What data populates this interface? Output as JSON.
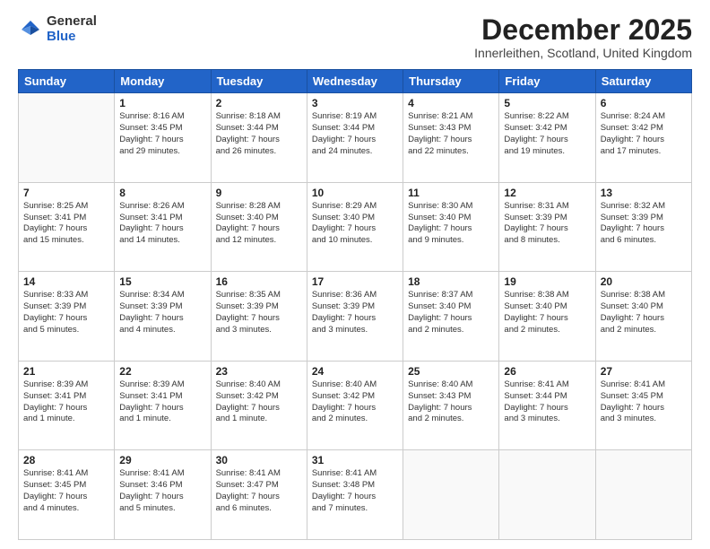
{
  "header": {
    "logo_general": "General",
    "logo_blue": "Blue",
    "month_title": "December 2025",
    "location": "Innerleithen, Scotland, United Kingdom"
  },
  "weekdays": [
    "Sunday",
    "Monday",
    "Tuesday",
    "Wednesday",
    "Thursday",
    "Friday",
    "Saturday"
  ],
  "weeks": [
    [
      {
        "day": "",
        "info": ""
      },
      {
        "day": "1",
        "info": "Sunrise: 8:16 AM\nSunset: 3:45 PM\nDaylight: 7 hours\nand 29 minutes."
      },
      {
        "day": "2",
        "info": "Sunrise: 8:18 AM\nSunset: 3:44 PM\nDaylight: 7 hours\nand 26 minutes."
      },
      {
        "day": "3",
        "info": "Sunrise: 8:19 AM\nSunset: 3:44 PM\nDaylight: 7 hours\nand 24 minutes."
      },
      {
        "day": "4",
        "info": "Sunrise: 8:21 AM\nSunset: 3:43 PM\nDaylight: 7 hours\nand 22 minutes."
      },
      {
        "day": "5",
        "info": "Sunrise: 8:22 AM\nSunset: 3:42 PM\nDaylight: 7 hours\nand 19 minutes."
      },
      {
        "day": "6",
        "info": "Sunrise: 8:24 AM\nSunset: 3:42 PM\nDaylight: 7 hours\nand 17 minutes."
      }
    ],
    [
      {
        "day": "7",
        "info": "Sunrise: 8:25 AM\nSunset: 3:41 PM\nDaylight: 7 hours\nand 15 minutes."
      },
      {
        "day": "8",
        "info": "Sunrise: 8:26 AM\nSunset: 3:41 PM\nDaylight: 7 hours\nand 14 minutes."
      },
      {
        "day": "9",
        "info": "Sunrise: 8:28 AM\nSunset: 3:40 PM\nDaylight: 7 hours\nand 12 minutes."
      },
      {
        "day": "10",
        "info": "Sunrise: 8:29 AM\nSunset: 3:40 PM\nDaylight: 7 hours\nand 10 minutes."
      },
      {
        "day": "11",
        "info": "Sunrise: 8:30 AM\nSunset: 3:40 PM\nDaylight: 7 hours\nand 9 minutes."
      },
      {
        "day": "12",
        "info": "Sunrise: 8:31 AM\nSunset: 3:39 PM\nDaylight: 7 hours\nand 8 minutes."
      },
      {
        "day": "13",
        "info": "Sunrise: 8:32 AM\nSunset: 3:39 PM\nDaylight: 7 hours\nand 6 minutes."
      }
    ],
    [
      {
        "day": "14",
        "info": "Sunrise: 8:33 AM\nSunset: 3:39 PM\nDaylight: 7 hours\nand 5 minutes."
      },
      {
        "day": "15",
        "info": "Sunrise: 8:34 AM\nSunset: 3:39 PM\nDaylight: 7 hours\nand 4 minutes."
      },
      {
        "day": "16",
        "info": "Sunrise: 8:35 AM\nSunset: 3:39 PM\nDaylight: 7 hours\nand 3 minutes."
      },
      {
        "day": "17",
        "info": "Sunrise: 8:36 AM\nSunset: 3:39 PM\nDaylight: 7 hours\nand 3 minutes."
      },
      {
        "day": "18",
        "info": "Sunrise: 8:37 AM\nSunset: 3:40 PM\nDaylight: 7 hours\nand 2 minutes."
      },
      {
        "day": "19",
        "info": "Sunrise: 8:38 AM\nSunset: 3:40 PM\nDaylight: 7 hours\nand 2 minutes."
      },
      {
        "day": "20",
        "info": "Sunrise: 8:38 AM\nSunset: 3:40 PM\nDaylight: 7 hours\nand 2 minutes."
      }
    ],
    [
      {
        "day": "21",
        "info": "Sunrise: 8:39 AM\nSunset: 3:41 PM\nDaylight: 7 hours\nand 1 minute."
      },
      {
        "day": "22",
        "info": "Sunrise: 8:39 AM\nSunset: 3:41 PM\nDaylight: 7 hours\nand 1 minute."
      },
      {
        "day": "23",
        "info": "Sunrise: 8:40 AM\nSunset: 3:42 PM\nDaylight: 7 hours\nand 1 minute."
      },
      {
        "day": "24",
        "info": "Sunrise: 8:40 AM\nSunset: 3:42 PM\nDaylight: 7 hours\nand 2 minutes."
      },
      {
        "day": "25",
        "info": "Sunrise: 8:40 AM\nSunset: 3:43 PM\nDaylight: 7 hours\nand 2 minutes."
      },
      {
        "day": "26",
        "info": "Sunrise: 8:41 AM\nSunset: 3:44 PM\nDaylight: 7 hours\nand 3 minutes."
      },
      {
        "day": "27",
        "info": "Sunrise: 8:41 AM\nSunset: 3:45 PM\nDaylight: 7 hours\nand 3 minutes."
      }
    ],
    [
      {
        "day": "28",
        "info": "Sunrise: 8:41 AM\nSunset: 3:45 PM\nDaylight: 7 hours\nand 4 minutes."
      },
      {
        "day": "29",
        "info": "Sunrise: 8:41 AM\nSunset: 3:46 PM\nDaylight: 7 hours\nand 5 minutes."
      },
      {
        "day": "30",
        "info": "Sunrise: 8:41 AM\nSunset: 3:47 PM\nDaylight: 7 hours\nand 6 minutes."
      },
      {
        "day": "31",
        "info": "Sunrise: 8:41 AM\nSunset: 3:48 PM\nDaylight: 7 hours\nand 7 minutes."
      },
      {
        "day": "",
        "info": ""
      },
      {
        "day": "",
        "info": ""
      },
      {
        "day": "",
        "info": ""
      }
    ]
  ]
}
